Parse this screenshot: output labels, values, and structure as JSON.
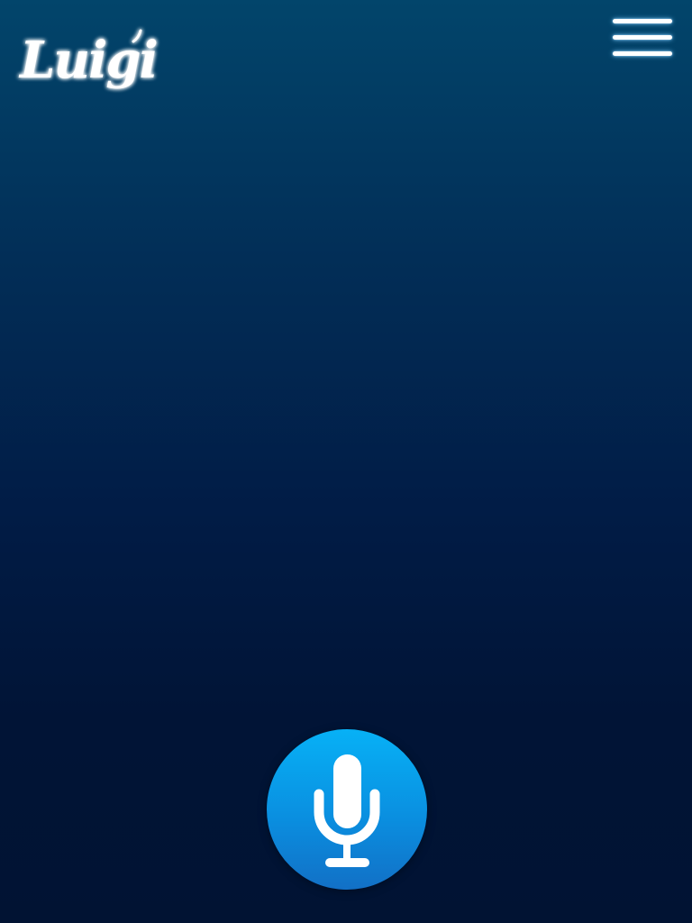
{
  "app": {
    "logo_text": "Luigi"
  },
  "header": {
    "menu_icon": "hamburger-menu-icon"
  },
  "voice": {
    "mic_icon": "microphone-icon"
  },
  "colors": {
    "background_top": "#02456b",
    "background_bottom": "#011333",
    "mic_button_top": "#07b1f6",
    "mic_button_bottom": "#1270c6",
    "foreground": "#ffffff"
  }
}
